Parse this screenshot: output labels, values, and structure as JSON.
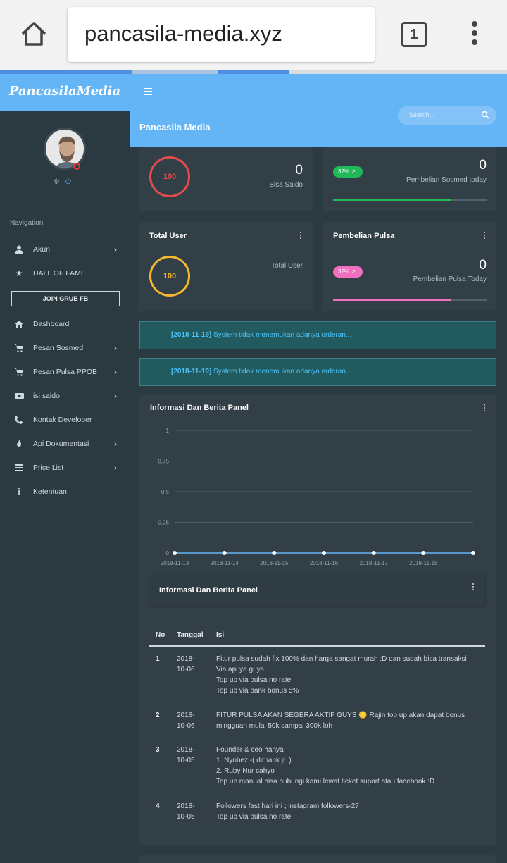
{
  "browser": {
    "url": "pancasila-media.xyz",
    "tab_count": "1"
  },
  "sidebar": {
    "brand": "PancasilaMedia",
    "nav_heading": "Navigation",
    "join_button": "JOIN GRUB FB",
    "items": [
      {
        "label": "Akun",
        "icon": "user-icon",
        "chevron": true
      },
      {
        "label": "HALL OF FAME",
        "icon": "star-icon",
        "chevron": false
      },
      {
        "label": "Dashboard",
        "icon": "home-icon",
        "chevron": false
      },
      {
        "label": "Pesan Sosmed",
        "icon": "cart-icon",
        "chevron": true
      },
      {
        "label": "Pesan Pulsa PPOB",
        "icon": "cart-icon",
        "chevron": true
      },
      {
        "label": "isi saldo",
        "icon": "money-icon",
        "chevron": true
      },
      {
        "label": "Kontak Developer",
        "icon": "phone-icon",
        "chevron": false
      },
      {
        "label": "Api Dokumentasi",
        "icon": "fire-icon",
        "chevron": true
      },
      {
        "label": "Price List",
        "icon": "list-icon",
        "chevron": true
      },
      {
        "label": "Ketentuan",
        "icon": "info-icon",
        "chevron": false
      }
    ]
  },
  "header": {
    "site_title": "Pancasila Media",
    "search_placeholder": "Search..."
  },
  "cards": {
    "saldo": {
      "ring_value": "100",
      "value": "0",
      "label": "Sisa Saldo"
    },
    "sosmed": {
      "badge": "32% ↗",
      "value": "0",
      "label": "Pembelian Sosmed today",
      "progress": 0.77
    },
    "total_user": {
      "title": "Total User",
      "ring_value": "100",
      "label": "Total User"
    },
    "pulsa": {
      "title": "Pembelian Pulsa",
      "badge": "32% ↗",
      "value": "0",
      "label": "Pembelian Pulsa Today",
      "progress": 0.77
    }
  },
  "alerts": [
    {
      "date": "[2018-11-19]",
      "text": " System tidak menemukan adanya orderan..."
    },
    {
      "date": "[2018-11-19]",
      "text": " System tidak menemukan adanya orderan..."
    }
  ],
  "panel": {
    "title": "Informasi Dan Berita Panel",
    "news_title": "Informasi Dan Berita Panel",
    "table_headers": [
      "No",
      "Tanggal",
      "Isi"
    ],
    "rows": [
      {
        "no": "1",
        "date": [
          "2018-",
          "10-06"
        ],
        "isi": [
          "Fitur pulsa sudah fix 100% dan harga sangat murah :D dan sudah bisa transaksi",
          "Via api ya guys",
          "Top up via pulsa no rate",
          "Top up via bank bonus 5%"
        ]
      },
      {
        "no": "2",
        "date": [
          "2018-",
          "10-06"
        ],
        "isi": [
          "FITUR PULSA AKAN SEGERA AKTIF GUYS 😊 Rajin top up akan dapat bonus",
          "mingguan mulai 50k sampai 300k loh"
        ]
      },
      {
        "no": "3",
        "date": [
          "2018-",
          "10-05"
        ],
        "isi": [
          "Founder & ceo hanya",
          "1. Nyobez -( dirhank jr. )",
          "2. Ruby Nur cahyo",
          "Top up manual bisa hubungi kami lewat ticket suport atau facebook :D"
        ]
      },
      {
        "no": "4",
        "date": [
          "2018-",
          "10-05"
        ],
        "isi": [
          "Followers fast hari ini ; instagram followers-27",
          "Top up via pulsa no rate !"
        ]
      }
    ]
  },
  "chart_data": {
    "type": "line",
    "x": [
      "2018-11-13",
      "2018-11-14",
      "2018-11-15",
      "2018-11-16",
      "2018-11-17",
      "2018-11-18",
      ""
    ],
    "series": [
      {
        "values": [
          0,
          0,
          0,
          0,
          0,
          0,
          0
        ]
      }
    ],
    "ylim": [
      0,
      1
    ],
    "yticks": [
      "1",
      "0.75",
      "0.5",
      "0.25",
      "0"
    ],
    "grid": true,
    "colors": {
      "line": "#64b5f6",
      "point": "#ffffff"
    }
  }
}
